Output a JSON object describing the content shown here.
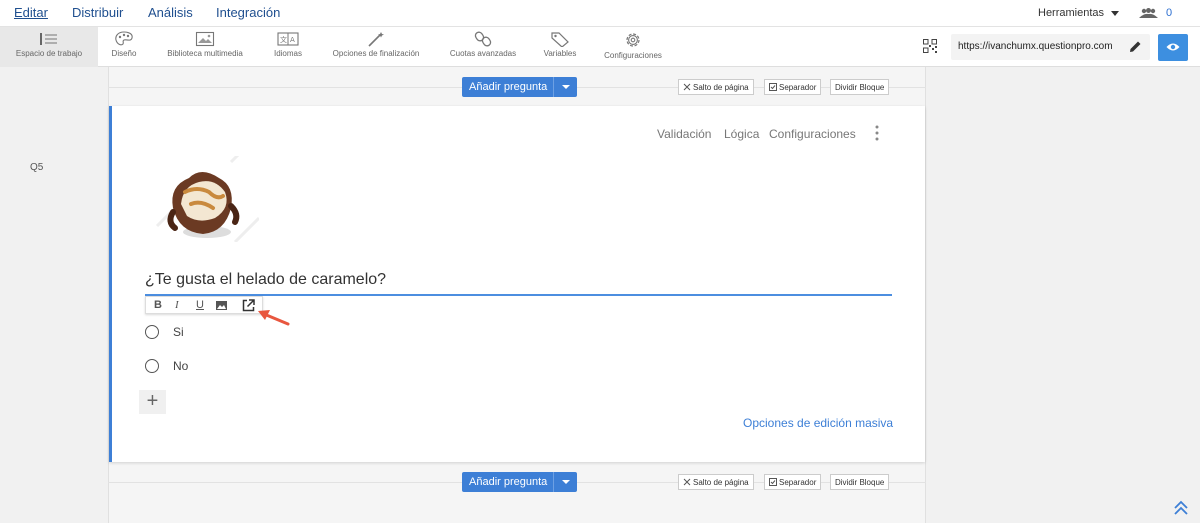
{
  "nav": {
    "tabs": [
      "Editar",
      "Distribuir",
      "Análisis",
      "Integración"
    ],
    "tools_label": "Herramientas",
    "users_count": "0"
  },
  "toolbar": {
    "items": [
      {
        "label": "Espacio de trabajo",
        "icon": "workspace-icon"
      },
      {
        "label": "Diseño",
        "icon": "palette-icon"
      },
      {
        "label": "Biblioteca multimedia",
        "icon": "image-icon"
      },
      {
        "label": "Idiomas",
        "icon": "translate-icon"
      },
      {
        "label": "Opciones de finalización",
        "icon": "magic-wand-icon"
      },
      {
        "label": "Cuotas avanzadas",
        "icon": "link-icon"
      },
      {
        "label": "Variables",
        "icon": "tag-icon"
      },
      {
        "label": "Configuraciones",
        "icon": "gear-icon"
      }
    ],
    "url": "https://ivanchumx.questionpro.com"
  },
  "block_bar": {
    "add_question": "Añadir pregunta",
    "page_break": "Salto de página",
    "separator": "Separador",
    "split_block": "Dividir Bloque"
  },
  "question": {
    "number": "Q5",
    "links": [
      "Validación",
      "Lógica",
      "Configuraciones"
    ],
    "text": "¿Te gusta el helado de caramelo?",
    "format_buttons": [
      "B",
      "I",
      "U"
    ],
    "options": [
      "Si",
      "No"
    ],
    "bulk_edit": "Opciones de edición masiva"
  },
  "colors": {
    "accent": "#3d7fd6",
    "nav_text": "#1f4f8f",
    "annotation_arrow": "#e8573f"
  }
}
